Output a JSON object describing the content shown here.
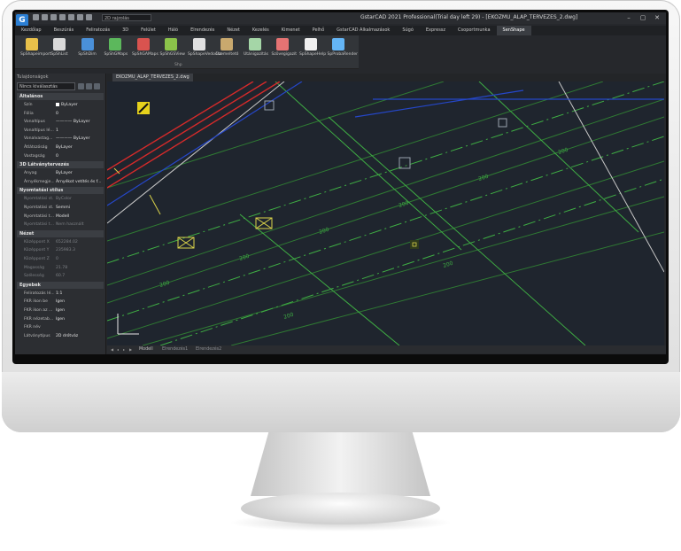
{
  "window": {
    "title": "GstarCAD 2021 Professional(Trial day left 29) - [EKOZMU_ALAP_TERVEZES_2.dwg]",
    "controls": [
      "–",
      "▢",
      "✕"
    ]
  },
  "quick_access": {
    "drawing_select": "2D rajzolás"
  },
  "menubar": {
    "items": [
      "Kezdőlap",
      "Beszúrás",
      "Feliratozás",
      "3D",
      "Felület",
      "Háló",
      "Elrendezés",
      "Nézet",
      "Kezelés",
      "Kimenet",
      "Pelhő",
      "GstarCAD Alkalmazások",
      "Súgó",
      "Expressz",
      "Csoportmunka",
      "SenShape"
    ],
    "active": "SenShape"
  },
  "ribbon": {
    "group_label": "Shp",
    "buttons": [
      {
        "label": "SpShapeimport",
        "icon": "shape-import-icon",
        "color": "#e8c04a"
      },
      {
        "label": "SpShList",
        "icon": "shape-list-icon",
        "color": "#d9d9d9"
      },
      {
        "label": "SpShDim",
        "icon": "shape-dimension-icon",
        "color": "#4a90d9"
      },
      {
        "label": "SpShGMaps",
        "icon": "google-maps-icon",
        "color": "#5cb85c"
      },
      {
        "label": "SpShGAMaps",
        "icon": "google-satellite-icon",
        "color": "#d9534f"
      },
      {
        "label": "SpShGSView",
        "icon": "street-view-icon",
        "color": "#8bc34a"
      },
      {
        "label": "SpShapeVedocso",
        "icon": "vcs-icon",
        "color": "#e0e0e0"
      },
      {
        "label": "Üzemeltető",
        "icon": "operator-icon",
        "color": "#c9a96e"
      },
      {
        "label": "Utánigazítás",
        "icon": "adjust-icon",
        "color": "#a5d6a7"
      },
      {
        "label": "Szövegigazít",
        "icon": "text-align-icon",
        "color": "#e57373"
      },
      {
        "label": "SpShapeHelp",
        "icon": "help-icon",
        "color": "#f0f0f0"
      },
      {
        "label": "SpProbaRender",
        "icon": "render-icon",
        "color": "#64b5f6"
      }
    ]
  },
  "properties": {
    "panel_title": "Tulajdonságok",
    "selection": "Nincs kiválasztás",
    "sections": [
      {
        "title": "Általános",
        "rows": [
          {
            "key": "Szín",
            "value": "ByLayer",
            "swatch": "#ffffff"
          },
          {
            "key": "Fólia",
            "value": "0"
          },
          {
            "key": "Vonaltípus",
            "value": "———— ByLayer"
          },
          {
            "key": "Vonaltípus lé...",
            "value": "1"
          },
          {
            "key": "Vonalvastag...",
            "value": "———— ByLayer"
          },
          {
            "key": "Átlátszóság",
            "value": "ByLayer"
          },
          {
            "key": "Vastagság",
            "value": "0"
          }
        ]
      },
      {
        "title": "3D Látványtervezés",
        "rows": [
          {
            "key": "Anyag",
            "value": "ByLayer"
          },
          {
            "key": "Árnyékmegje...",
            "value": "Árnyékot vetítés és f..."
          }
        ]
      },
      {
        "title": "Nyomtatási stílus",
        "rows": [
          {
            "key": "Nyomtatási st...",
            "value": "ByColor",
            "dim": true
          },
          {
            "key": "Nyomtatási st...",
            "value": "Semmi"
          },
          {
            "key": "Nyomtatási t...",
            "value": "Modell"
          },
          {
            "key": "Nyomtatási t...",
            "value": "Nem használt",
            "dim": true
          }
        ]
      },
      {
        "title": "Nézet",
        "rows": [
          {
            "key": "Középpont X",
            "value": "652284.02",
            "dim": true
          },
          {
            "key": "Középpont Y",
            "value": "235983.3",
            "dim": true
          },
          {
            "key": "Középpont Z",
            "value": "0",
            "dim": true
          },
          {
            "key": "Magasság",
            "value": "21.78",
            "dim": true
          },
          {
            "key": "Szélesség",
            "value": "60.7",
            "dim": true
          }
        ]
      },
      {
        "title": "Egyebek",
        "rows": [
          {
            "key": "Feliratozás lé...",
            "value": "1:1"
          },
          {
            "key": "FKR ikon be",
            "value": "Igen"
          },
          {
            "key": "FKR ikon az ...",
            "value": "Igen"
          },
          {
            "key": "FKR nézetab...",
            "value": "Igen"
          },
          {
            "key": "FKR név",
            "value": ""
          },
          {
            "key": "Látványtípus",
            "value": "2D drótváz"
          }
        ]
      }
    ]
  },
  "document_tab": "EKOZMU_ALAP_TERVEZES_2.dwg",
  "layout_tabs": [
    "Modell",
    "Elrendezés1",
    "Elrendezés2"
  ],
  "drawing_labels": [
    "200",
    "200",
    "200",
    "200",
    "200",
    "200",
    "200",
    "200"
  ]
}
